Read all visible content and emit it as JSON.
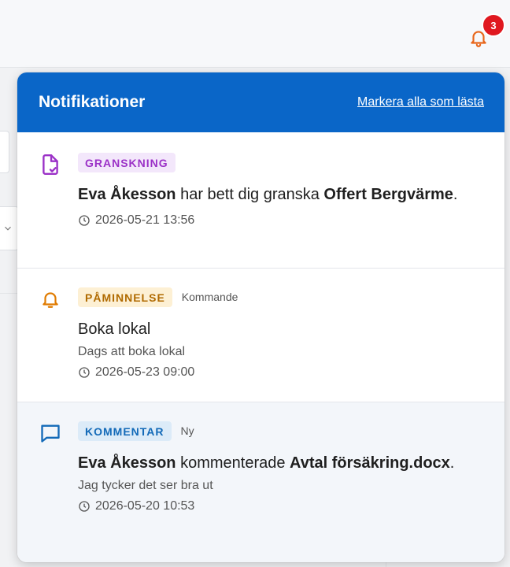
{
  "header": {
    "notification_count": "3"
  },
  "panel": {
    "title": "Notifikationer",
    "mark_all_label": "Markera alla som lästa"
  },
  "notifications": [
    {
      "tag": "GRANSKNING",
      "extra": "",
      "actor": "Eva Åkesson",
      "action": " har bett dig granska ",
      "object": "Offert Bergvärme",
      "suffix": ".",
      "description": "",
      "time": "2026-05-21 13:56",
      "icon": "document-review-icon"
    },
    {
      "tag": "PÅMINNELSE",
      "extra": "Kommande",
      "title": "Boka lokal",
      "description": "Dags att boka lokal",
      "time": "2026-05-23 09:00",
      "icon": "bell-icon"
    },
    {
      "tag": "KOMMENTAR",
      "extra": "Ny",
      "actor": "Eva Åkesson",
      "action": " kommenterade ",
      "object": "Avtal försäkring.docx",
      "suffix": ".",
      "description": "Jag tycker det ser bra ut",
      "time": "2026-05-20 10:53",
      "icon": "comment-icon"
    }
  ],
  "colors": {
    "header_blue": "#0a66c8",
    "badge_red": "#e0181f",
    "review_purple": "#9b31c7",
    "reminder_orange": "#e07b00",
    "comment_blue": "#136ab8"
  }
}
